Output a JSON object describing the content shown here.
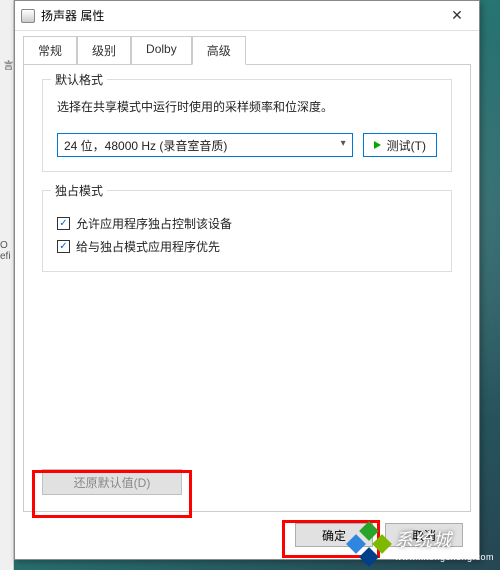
{
  "window": {
    "title": "扬声器 属性",
    "close_glyph": "✕"
  },
  "tabs": {
    "items": [
      "常规",
      "级别",
      "Dolby",
      "高级"
    ],
    "active_index": 3
  },
  "group_default_format": {
    "label": "默认格式",
    "description": "选择在共享模式中运行时使用的采样频率和位深度。",
    "select_value": "24 位，48000 Hz (录音室音质)",
    "test_label": "测试(T)"
  },
  "group_exclusive": {
    "label": "独占模式",
    "check1_label": "允许应用程序独占控制该设备",
    "check1_checked": true,
    "check2_label": "给与独占模式应用程序优先",
    "check2_checked": true
  },
  "restore_button": "还原默认值(D)",
  "dialog_buttons": {
    "ok": "确定",
    "cancel": "取消"
  },
  "watermark": {
    "text": "系统城",
    "sub": "www.xitongcheng.com",
    "colors": [
      "#29a329",
      "#2e86de",
      "#003f8a",
      "#7fb800"
    ]
  },
  "side": {
    "t1": "言",
    "t2": "O\nefi"
  }
}
